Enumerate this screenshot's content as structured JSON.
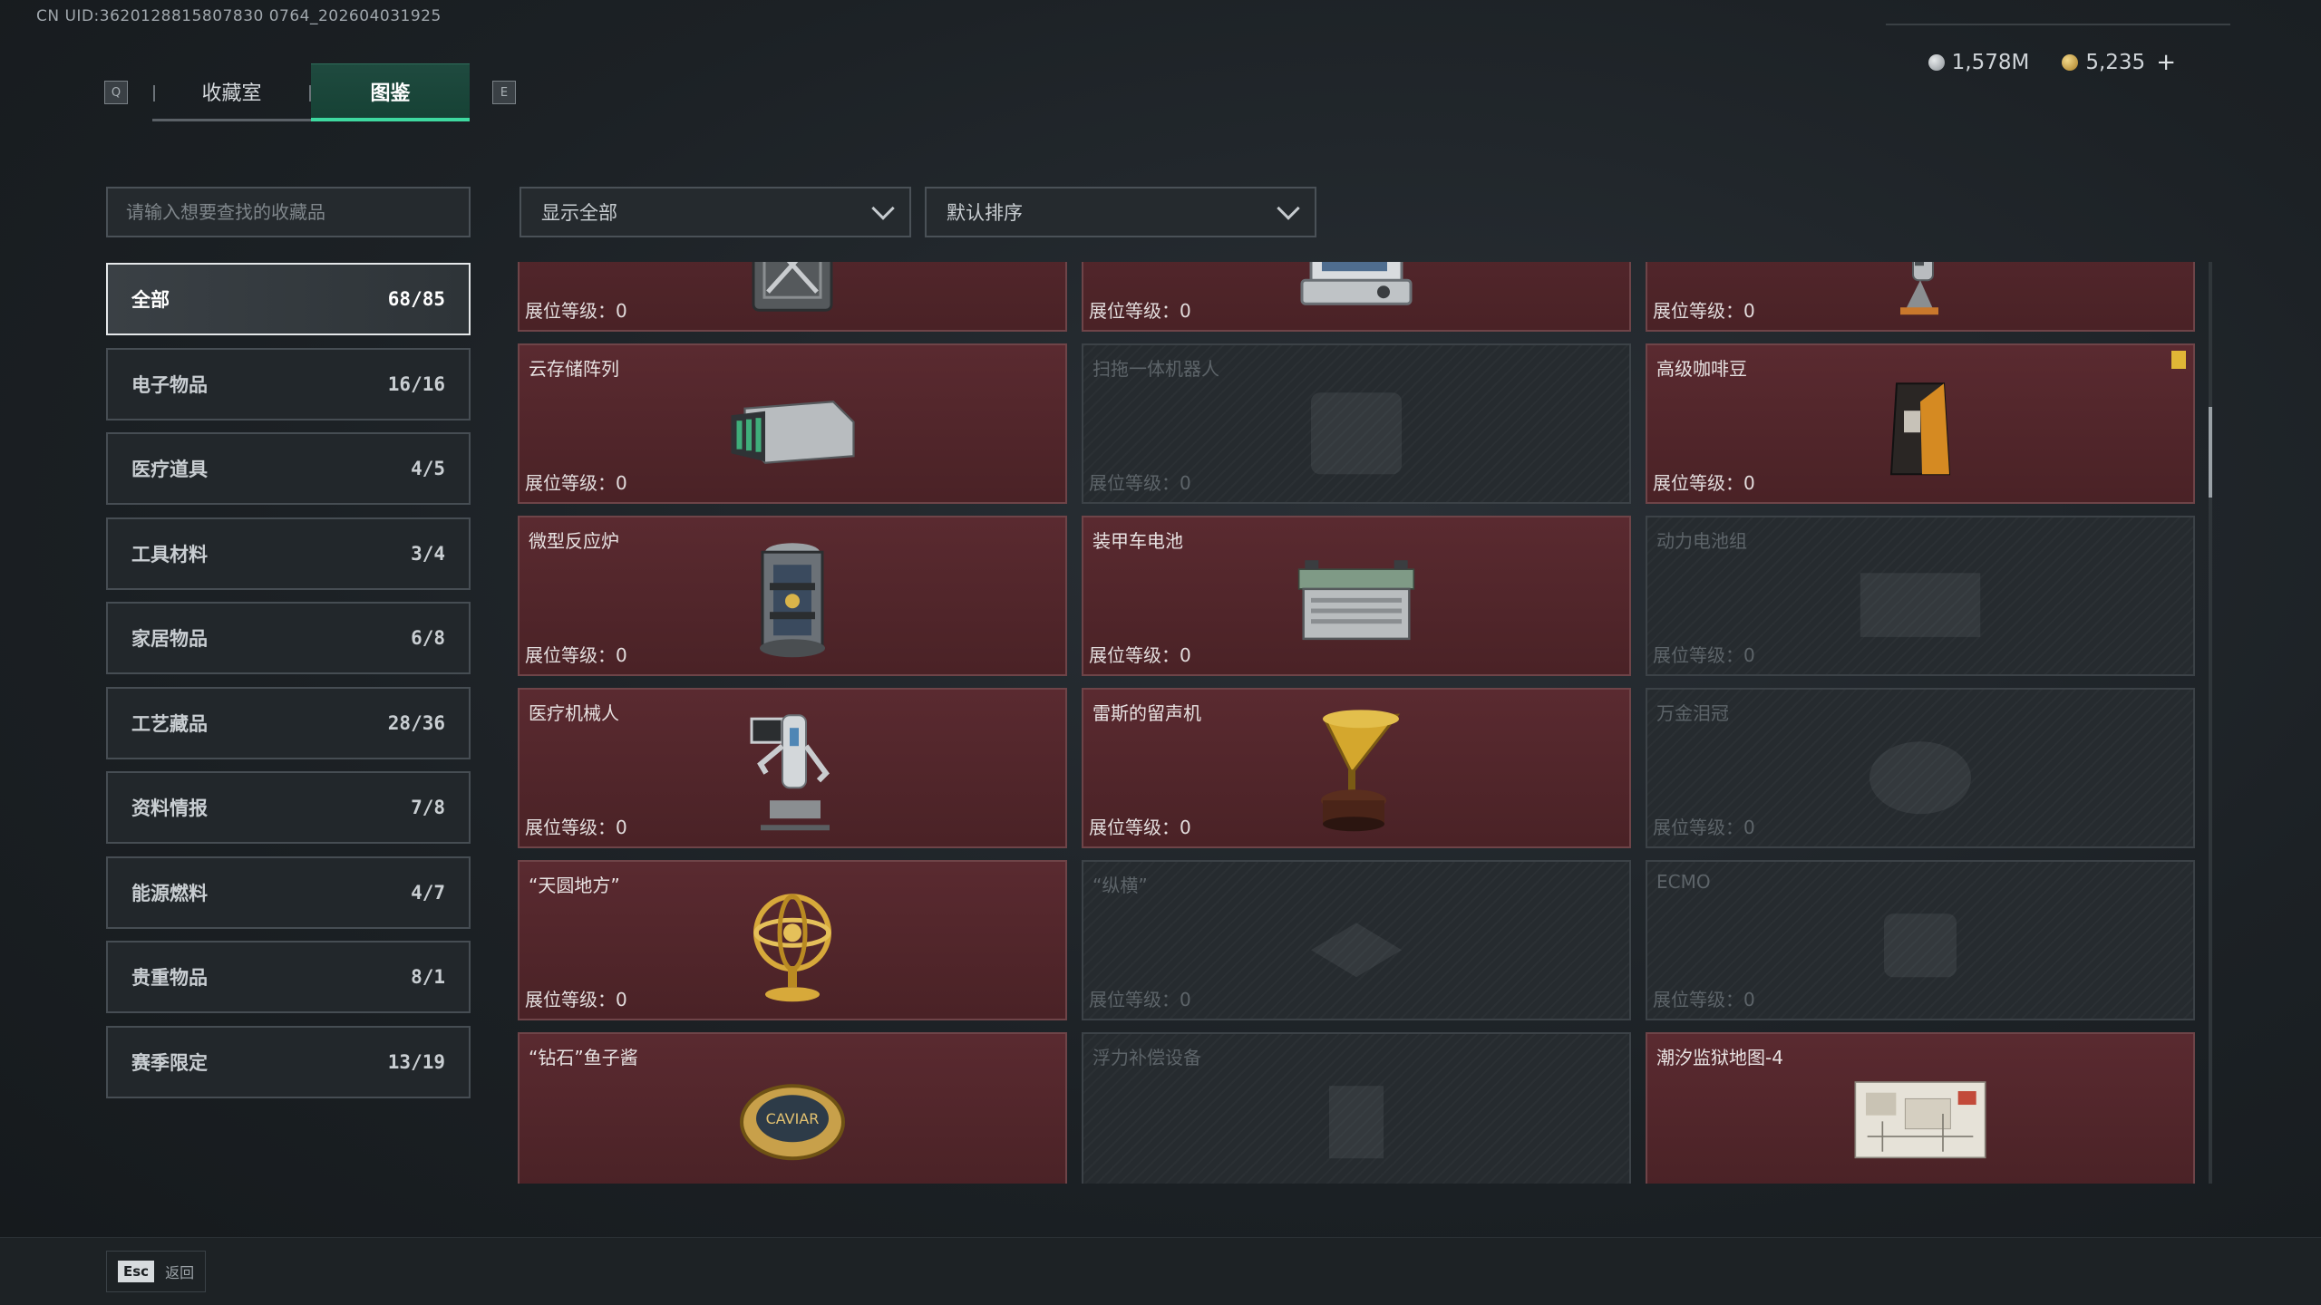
{
  "uid_text": "CN UID:3620128815807830 0764_202604031925",
  "header": {
    "key_left": "Q",
    "key_right": "E",
    "tabs": [
      {
        "label": "收藏室",
        "active": false
      },
      {
        "label": "图鉴",
        "active": true
      }
    ]
  },
  "currency": {
    "silver": "1,578M",
    "gold": "5,235",
    "plus": "+"
  },
  "search": {
    "placeholder": "请输入想要查找的收藏品"
  },
  "filters": {
    "show": "显示全部",
    "sort": "默认排序"
  },
  "categories": [
    {
      "label": "全部",
      "count": "68/85"
    },
    {
      "label": "电子物品",
      "count": "16/16"
    },
    {
      "label": "医疗道具",
      "count": "4/5"
    },
    {
      "label": "工具材料",
      "count": "3/4"
    },
    {
      "label": "家居物品",
      "count": "6/8"
    },
    {
      "label": "工艺藏品",
      "count": "28/36"
    },
    {
      "label": "资料情报",
      "count": "7/8"
    },
    {
      "label": "能源燃料",
      "count": "4/7"
    },
    {
      "label": "贵重物品",
      "count": "8/1"
    },
    {
      "label": "赛季限定",
      "count": "13/19"
    }
  ],
  "level_prefix": "展位等级：",
  "items": [
    {
      "name": "",
      "level": "0",
      "owned": true,
      "icon": "jerrycan-icon"
    },
    {
      "name": "",
      "level": "0",
      "owned": true,
      "icon": "terminal-icon"
    },
    {
      "name": "",
      "level": "0",
      "owned": true,
      "icon": "vacuum-icon"
    },
    {
      "name": "云存储阵列",
      "level": "0",
      "owned": true,
      "icon": "storage-array-icon"
    },
    {
      "name": "扫拖一体机器人",
      "level": "0",
      "owned": false,
      "icon": "robot-vacuum-icon"
    },
    {
      "name": "高级咖啡豆",
      "level": "0",
      "owned": true,
      "icon": "coffee-bag-icon",
      "badge": true
    },
    {
      "name": "微型反应炉",
      "level": "0",
      "owned": true,
      "icon": "reactor-icon"
    },
    {
      "name": "装甲车电池",
      "level": "0",
      "owned": true,
      "icon": "battery-icon"
    },
    {
      "name": "动力电池组",
      "level": "0",
      "owned": false,
      "icon": "battery-pack-icon"
    },
    {
      "name": "医疗机械人",
      "level": "0",
      "owned": true,
      "icon": "medical-robot-icon"
    },
    {
      "name": "雷斯的留声机",
      "level": "0",
      "owned": true,
      "icon": "gramophone-icon"
    },
    {
      "name": "万金泪冠",
      "level": "0",
      "owned": false,
      "icon": "crown-icon"
    },
    {
      "name": "“天圆地方”",
      "level": "0",
      "owned": true,
      "icon": "armillary-icon"
    },
    {
      "name": "“纵横”",
      "level": "0",
      "owned": false,
      "icon": "chessboard-icon"
    },
    {
      "name": "ECMO",
      "level": "0",
      "owned": false,
      "icon": "ecmo-icon"
    },
    {
      "name": "“钻石”鱼子酱",
      "level": "",
      "owned": true,
      "icon": "caviar-icon"
    },
    {
      "name": "浮力补偿设备",
      "level": "",
      "owned": false,
      "icon": "bcd-icon"
    },
    {
      "name": "潮汐监狱地图-4",
      "level": "",
      "owned": true,
      "icon": "map-icon"
    }
  ],
  "footer": {
    "esc_key": "Esc",
    "esc_label": "返回"
  }
}
